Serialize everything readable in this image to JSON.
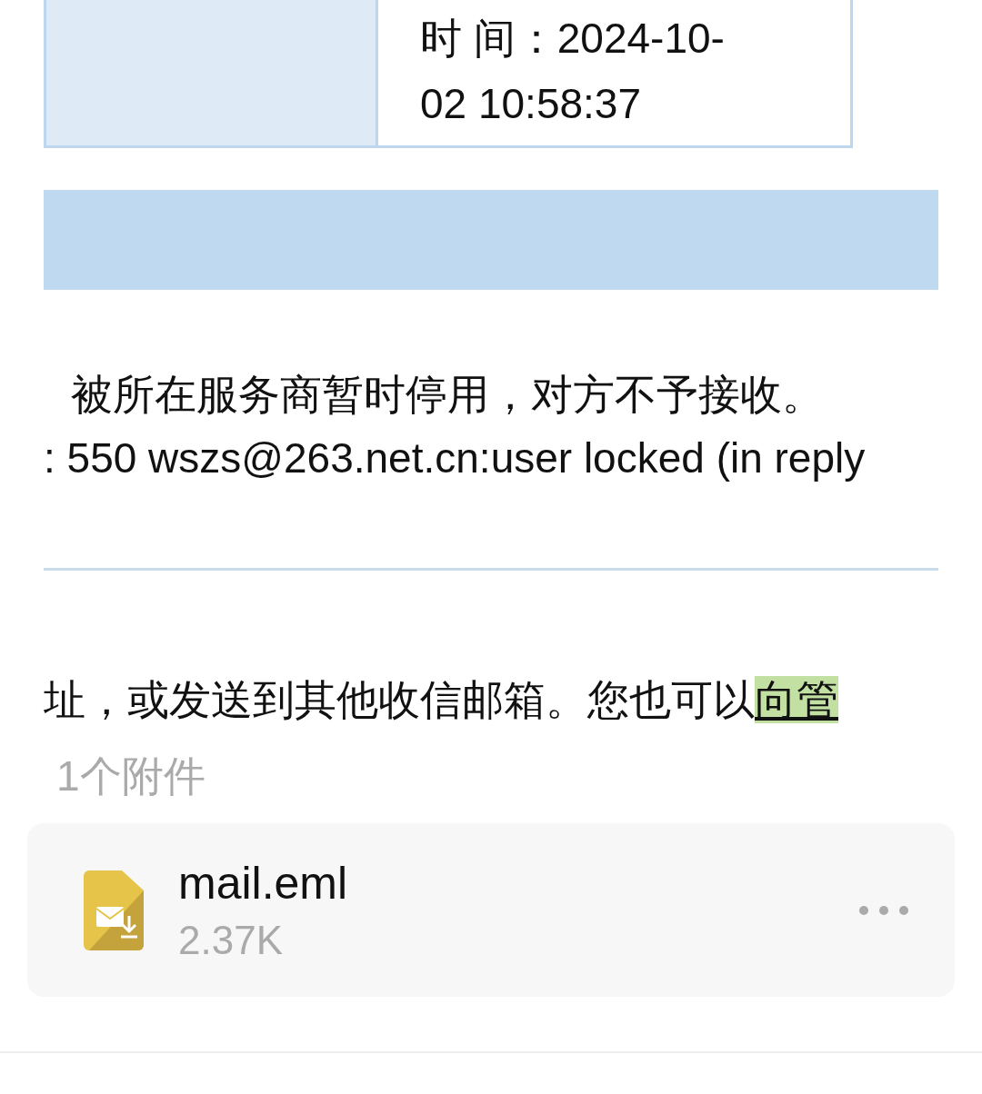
{
  "info_table": {
    "time_cell": "时 间：2024-10-02 10:58:37"
  },
  "bounce_lines": [
    "被所在服务商暂时停用，对方不予接收。",
    ": 550 wszs@263.net.cn:user locked (in reply"
  ],
  "hint": {
    "text": "址，或发送到其他收信邮箱。您也可以",
    "link": "向管"
  },
  "attachments": {
    "count_label": "1个附件",
    "items": [
      {
        "name": "mail.eml",
        "size": "2.37K"
      }
    ]
  }
}
